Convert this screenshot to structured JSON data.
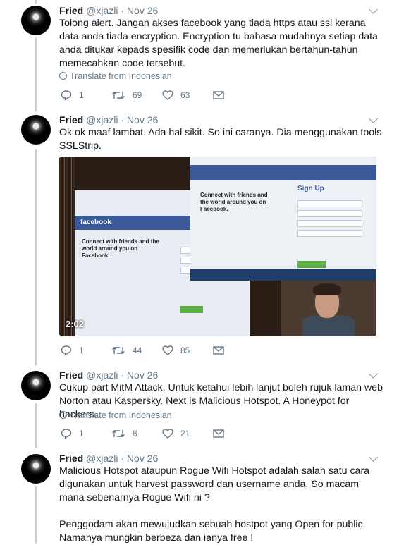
{
  "tweets": [
    {
      "name": "Fried",
      "handle": "@xjazli",
      "time": "Nov 26",
      "text": "Tolong alert. Jangan akses facebook yang tiada https atau ssl kerana data anda tiada encryption. Encryption tu bahasa mudahnya setiap data anda ditukar kepads spesifik code dan memerlukan bertahun-tahun memecahkan code tersebut.",
      "translate": "Translate from Indonesian",
      "replies": "1",
      "retweets": "69",
      "likes": "63"
    },
    {
      "name": "Fried",
      "handle": "@xjazli",
      "time": "Nov 26",
      "text": "Ok ok maaf lambat. Ada hal sikit. So ini caranya. Dia menggunakan tools SSLStrip.",
      "media": {
        "duration": "2:02",
        "fb_logo": "facebook",
        "connect_text": "Connect with friends and the world around you on Facebook.",
        "signup_text": "Sign Up"
      },
      "replies": "1",
      "retweets": "44",
      "likes": "85"
    },
    {
      "name": "Fried",
      "handle": "@xjazli",
      "time": "Nov 26",
      "text": "Cukup part MitM Attack. Untuk ketahui lebih lanjut boleh rujuk laman web Norton atau Kaspersky. Next is Malicious Hotspot. A Honeypot for hackers.",
      "translate": "Translate from Indonesian",
      "replies": "1",
      "retweets": "8",
      "likes": "21"
    },
    {
      "name": "Fried",
      "handle": "@xjazli",
      "time": "Nov 26",
      "text": "Malicious Hotspot ataupun Rogue Wifi Hotspot adalah salah satu cara digunakan untuk harvest password dan username anda. So macam mana sebenarnya Rogue Wifi ni ?\n\nPenggodam akan mewujudkan sebuah hostpot yang Open for public. Namanya mungkin berbeza dan ianya free !"
    }
  ],
  "colors": {
    "thread_line": "#c4cfd6",
    "muted": "#657786",
    "text": "#14171a"
  },
  "icons": {
    "reply": "reply-icon",
    "retweet": "retweet-icon",
    "like": "heart-icon",
    "dm": "envelope-icon",
    "translate": "globe-icon",
    "more": "chevron-down-icon"
  }
}
